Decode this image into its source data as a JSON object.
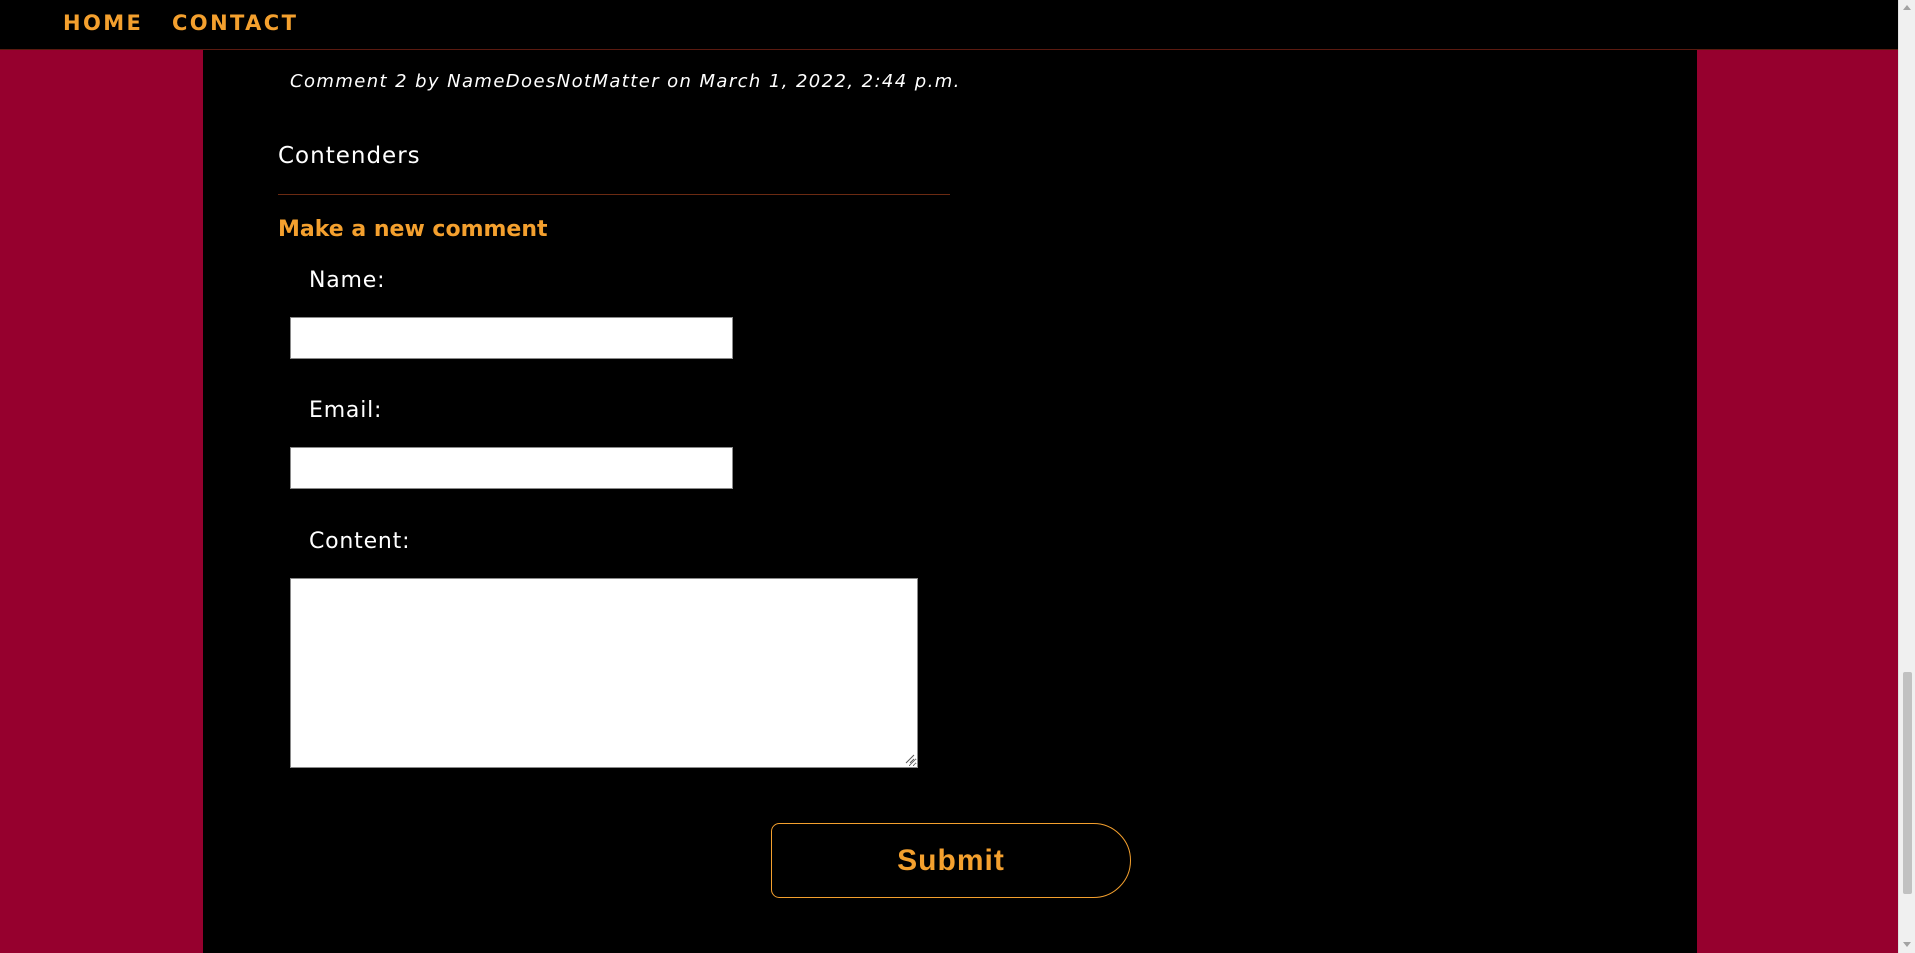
{
  "nav": {
    "home_label": "HOME",
    "contact_label": "CONTACT"
  },
  "comment": {
    "meta": "Comment 2 by NameDoesNotMatter on March 1, 2022, 2:44 p.m."
  },
  "post": {
    "title": "Contenders"
  },
  "form": {
    "heading": "Make a new comment",
    "name_label": "Name:",
    "name_value": "",
    "email_label": "Email:",
    "email_value": "",
    "content_label": "Content:",
    "content_value": "",
    "submit_label": "Submit"
  },
  "colors": {
    "page_background": "#96002e",
    "content_background": "#000000",
    "accent": "#f4a02e",
    "text": "#ffffff"
  },
  "icons": {
    "resize_grip": "resize-grip-icon",
    "scroll_up": "chevron-up-icon",
    "scroll_down": "chevron-down-icon"
  }
}
